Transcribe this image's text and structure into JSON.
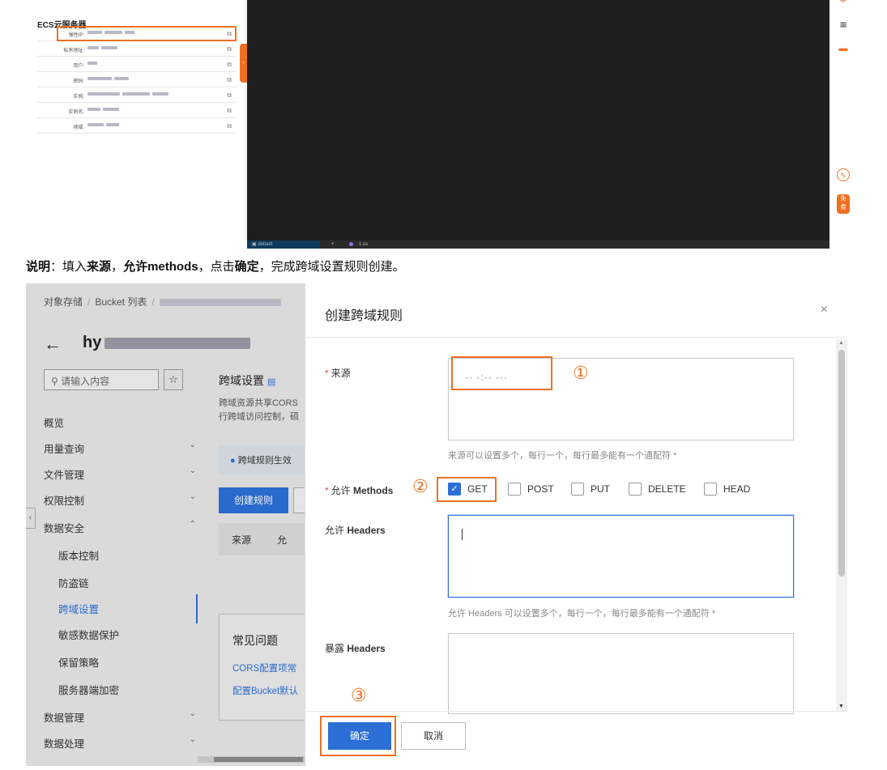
{
  "top": {
    "ecs_title": "ECS云服务器",
    "rows": [
      {
        "key": "弹性IP:"
      },
      {
        "key": "私有地址:"
      },
      {
        "key": "用户:"
      },
      {
        "key": "密码:"
      },
      {
        "key": "实例:"
      },
      {
        "key": "实例名:"
      },
      {
        "key": "地域:"
      }
    ],
    "copy_icon": "copy-icon",
    "terminal": {
      "tab": "default",
      "plus": "+",
      "file": "1.ss"
    },
    "accent": "#f07022"
  },
  "note": {
    "prefix": "说明",
    "t1": "：填入",
    "b1": "来源",
    "t2": "，",
    "b2": "允许methods",
    "t3": "，点击",
    "b3": "确定",
    "t4": "，完成跨域设置规则创建。"
  },
  "console": {
    "breadcrumb": [
      "对象存储",
      "Bucket 列表"
    ],
    "back": "←",
    "bucket_prefix": "hy",
    "search_placeholder": "请输入内容",
    "sidebar": [
      {
        "label": "概览"
      },
      {
        "label": "用量查询",
        "chev": "⌄"
      },
      {
        "label": "文件管理",
        "chev": "⌄"
      },
      {
        "label": "权限控制",
        "chev": "⌄"
      },
      {
        "label": "数据安全",
        "chev": "⌃"
      },
      {
        "label": "版本控制"
      },
      {
        "label": "防盗链"
      },
      {
        "label": "跨域设置"
      },
      {
        "label": "敏感数据保护"
      },
      {
        "label": "保留策略"
      },
      {
        "label": "服务器端加密"
      },
      {
        "label": "数据管理",
        "chev": "⌄"
      },
      {
        "label": "数据处理",
        "chev": "⌄"
      }
    ],
    "main_title": "跨域设置",
    "main_desc_1": "跨域资源共享CORS",
    "main_desc_2": "行跨域访问控制，硕",
    "info": "跨域规则生效",
    "create_rule": "创建规则",
    "table_col": "来源",
    "table_col2": "允",
    "faq_title": "常见问题",
    "faq_links": [
      "CORS配置项常",
      "配置Bucket默认"
    ]
  },
  "dialog": {
    "title": "创建跨域规则",
    "close": "×",
    "origin_label": "来源",
    "origin_value": "·· ·:·· ···",
    "origin_hint": "来源可以设置多个，每行一个，每行最多能有一个通配符 *",
    "methods_label_a": "允许 ",
    "methods_label_b": "Methods",
    "methods": [
      {
        "label": "GET",
        "checked": true
      },
      {
        "label": "POST",
        "checked": false
      },
      {
        "label": "PUT",
        "checked": false
      },
      {
        "label": "DELETE",
        "checked": false
      },
      {
        "label": "HEAD",
        "checked": false
      }
    ],
    "headers_label_a": "允许 ",
    "headers_label_b": "Headers",
    "headers_hint": "允许 Headers 可以设置多个，每行一个，每行最多能有一个通配符 *",
    "expose_label_a": "暴露 ",
    "expose_label_b": "Headers",
    "ok": "确定",
    "cancel": "取消",
    "markers": [
      "①",
      "②",
      "③"
    ]
  }
}
